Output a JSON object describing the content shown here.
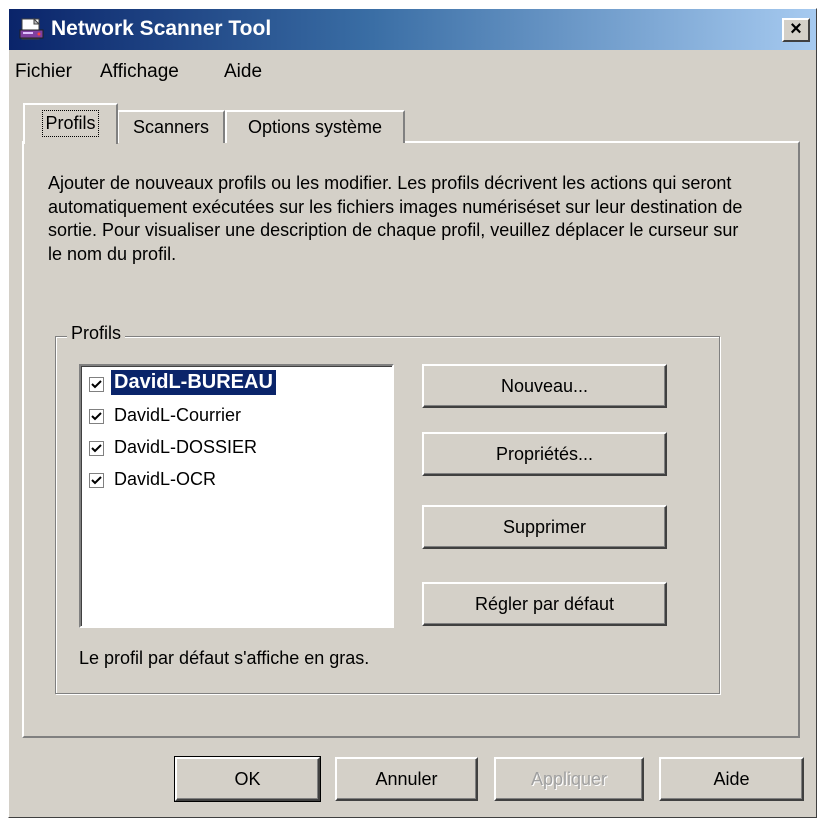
{
  "window": {
    "title": "Network Scanner Tool",
    "close_label": "×"
  },
  "menu": {
    "items": [
      "Fichier",
      "Affichage",
      "Aide"
    ]
  },
  "tabs": [
    {
      "label": "Profils",
      "active": true
    },
    {
      "label": "Scanners",
      "active": false
    },
    {
      "label": "Options système",
      "active": false
    }
  ],
  "profiles_tab": {
    "description": "Ajouter de nouveaux profils ou les modifier. Les profils décrivent les actions qui seront automatiquement exécutées sur les fichiers images numériséset sur leur destination de sortie. Pour visualiser une description de chaque profil, veuillez déplacer le curseur sur le nom du profil.",
    "group_label": "Profils",
    "profiles": [
      {
        "name": "DavidL-BUREAU",
        "checked": true,
        "default": true,
        "selected": true
      },
      {
        "name": "DavidL-Courrier",
        "checked": true,
        "default": false,
        "selected": false
      },
      {
        "name": "DavidL-DOSSIER",
        "checked": true,
        "default": false,
        "selected": false
      },
      {
        "name": "DavidL-OCR",
        "checked": true,
        "default": false,
        "selected": false
      }
    ],
    "buttons": {
      "new": "Nouveau...",
      "properties": "Propriétés...",
      "delete": "Supprimer",
      "set_default": "Régler par défaut"
    },
    "footnote": "Le profil par défaut s'affiche en gras."
  },
  "dialog_buttons": {
    "ok": "OK",
    "cancel": "Annuler",
    "apply": "Appliquer",
    "help": "Aide"
  },
  "colors": {
    "title_gradient_start": "#0a246a",
    "title_gradient_end": "#a6caf0",
    "face": "#d4d0c8",
    "selection": "#0a246a"
  }
}
